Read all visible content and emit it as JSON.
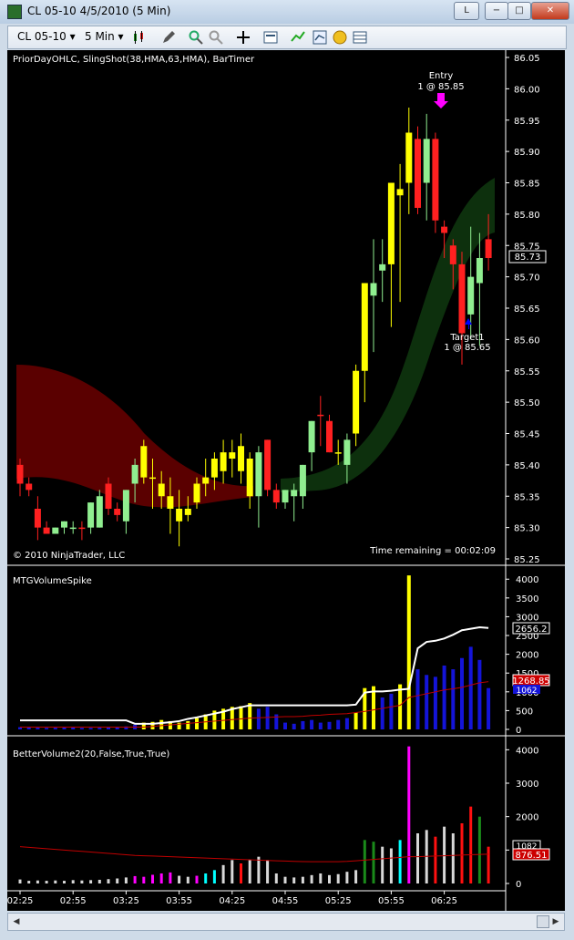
{
  "window": {
    "title": "CL 05-10  4/5/2010 (5 Min)",
    "btn_l": "L",
    "btn_min": "−",
    "btn_max": "□",
    "btn_close": "✕"
  },
  "toolbar": {
    "instrument": "CL 05-10 ▾",
    "period": "5 Min ▾",
    "icons": [
      "candlestick-icon",
      "pencil-icon",
      "zoom-in-icon",
      "zoom-out-icon",
      "crosshair-icon",
      "properties-icon",
      "indicators-icon",
      "strategies-icon",
      "money-icon",
      "data-box-icon"
    ]
  },
  "colors": {
    "bg": "#000000",
    "up_yellow": "#ffff00",
    "up_green": "#90ee90",
    "down_red": "#ff2020",
    "vol_blue": "#1414d8",
    "ma_white": "#ffffff",
    "ma_red": "#c00000",
    "ribbon_red": "#5a0000",
    "ribbon_green": "#0d300d"
  },
  "chart_data": [
    {
      "type": "candlestick",
      "title": "PriorDayOHLC, SlingShot(38,HMA,63,HMA), BarTimer",
      "copyright": "© 2010 NinjaTrader, LLC",
      "timer": "Time remaining = 00:02:09",
      "ylim": [
        85.25,
        86.05
      ],
      "yticks": [
        "86.05",
        "86.00",
        "85.95",
        "85.90",
        "85.85",
        "85.80",
        "85.75",
        "85.70",
        "85.65",
        "85.60",
        "85.55",
        "85.50",
        "85.45",
        "85.40",
        "85.35",
        "85.30",
        "85.25"
      ],
      "last_price_label": "85.73",
      "annotations": {
        "entry": "Entry",
        "entry_fill": "1 @ 85.85",
        "target": "Target1",
        "target_fill": "1 @ 85.65"
      },
      "bars": [
        [
          85.4,
          85.41,
          85.35,
          85.37,
          "r"
        ],
        [
          85.37,
          85.38,
          85.35,
          85.36,
          "r"
        ],
        [
          85.33,
          85.35,
          85.28,
          85.3,
          "r"
        ],
        [
          85.3,
          85.31,
          85.29,
          85.29,
          "r"
        ],
        [
          85.29,
          85.3,
          85.29,
          85.3,
          "g"
        ],
        [
          85.3,
          85.31,
          85.29,
          85.31,
          "g"
        ],
        [
          85.3,
          85.31,
          85.29,
          85.3,
          "g"
        ],
        [
          85.3,
          85.31,
          85.28,
          85.3,
          "r"
        ],
        [
          85.3,
          85.34,
          85.29,
          85.34,
          "g"
        ],
        [
          85.3,
          85.36,
          85.3,
          85.35,
          "g"
        ],
        [
          85.37,
          85.38,
          85.32,
          85.33,
          "r"
        ],
        [
          85.33,
          85.34,
          85.31,
          85.32,
          "r"
        ],
        [
          85.31,
          85.36,
          85.29,
          85.36,
          "g"
        ],
        [
          85.37,
          85.41,
          85.34,
          85.4,
          "g"
        ],
        [
          85.43,
          85.44,
          85.37,
          85.38,
          "y"
        ],
        [
          85.38,
          85.41,
          85.33,
          85.38,
          "y"
        ],
        [
          85.37,
          85.39,
          85.33,
          85.35,
          "y"
        ],
        [
          85.35,
          85.38,
          85.29,
          85.33,
          "y"
        ],
        [
          85.33,
          85.36,
          85.27,
          85.31,
          "y"
        ],
        [
          85.32,
          85.35,
          85.31,
          85.33,
          "y"
        ],
        [
          85.34,
          85.38,
          85.33,
          85.37,
          "y"
        ],
        [
          85.37,
          85.41,
          85.35,
          85.38,
          "y"
        ],
        [
          85.38,
          85.42,
          85.36,
          85.41,
          "y"
        ],
        [
          85.39,
          85.44,
          85.37,
          85.42,
          "y"
        ],
        [
          85.42,
          85.44,
          85.38,
          85.41,
          "y"
        ],
        [
          85.43,
          85.45,
          85.37,
          85.39,
          "y"
        ],
        [
          85.41,
          85.42,
          85.33,
          85.35,
          "y"
        ],
        [
          85.35,
          85.43,
          85.3,
          85.42,
          "g"
        ],
        [
          85.44,
          85.44,
          85.35,
          85.36,
          "r"
        ],
        [
          85.36,
          85.37,
          85.33,
          85.34,
          "r"
        ],
        [
          85.34,
          85.36,
          85.33,
          85.36,
          "g"
        ],
        [
          85.35,
          85.37,
          85.31,
          85.36,
          "g"
        ],
        [
          85.35,
          85.4,
          85.33,
          85.4,
          "g"
        ],
        [
          85.42,
          85.47,
          85.39,
          85.47,
          "g"
        ],
        [
          85.48,
          85.51,
          85.43,
          85.48,
          "r"
        ],
        [
          85.47,
          85.48,
          85.42,
          85.42,
          "r"
        ],
        [
          85.42,
          85.44,
          85.4,
          85.42,
          "y"
        ],
        [
          85.4,
          85.45,
          85.37,
          85.44,
          "g"
        ],
        [
          85.45,
          85.56,
          85.43,
          85.55,
          "y"
        ],
        [
          85.55,
          85.66,
          85.5,
          85.69,
          "y"
        ],
        [
          85.67,
          85.76,
          85.58,
          85.69,
          "g"
        ],
        [
          85.71,
          85.76,
          85.66,
          85.72,
          "g"
        ],
        [
          85.72,
          85.85,
          85.62,
          85.85,
          "y"
        ],
        [
          85.83,
          85.88,
          85.66,
          85.84,
          "y"
        ],
        [
          85.85,
          85.97,
          85.8,
          85.93,
          "y"
        ],
        [
          85.92,
          85.94,
          85.8,
          85.81,
          "r"
        ],
        [
          85.85,
          85.96,
          85.79,
          85.92,
          "g"
        ],
        [
          85.92,
          85.93,
          85.77,
          85.79,
          "r"
        ],
        [
          85.78,
          85.79,
          85.73,
          85.77,
          "r"
        ],
        [
          85.75,
          85.76,
          85.68,
          85.72,
          "r"
        ],
        [
          85.72,
          85.74,
          85.56,
          85.61,
          "r"
        ],
        [
          85.64,
          85.78,
          85.6,
          85.7,
          "g"
        ],
        [
          85.69,
          85.77,
          85.59,
          85.73,
          "g"
        ],
        [
          85.76,
          85.8,
          85.71,
          85.73,
          "r"
        ]
      ]
    },
    {
      "type": "bar",
      "title": "MTGVolumeSpike",
      "ylim": [
        0,
        4200
      ],
      "yticks": [
        "4000",
        "3500",
        "3000",
        "2500",
        "2000",
        "1500",
        "1000",
        "500",
        "0"
      ],
      "last_labels": [
        "2656.2",
        "1268.85",
        "1062"
      ],
      "values": [
        60,
        50,
        45,
        40,
        45,
        60,
        50,
        40,
        40,
        45,
        50,
        55,
        80,
        120,
        180,
        200,
        250,
        220,
        180,
        220,
        300,
        400,
        500,
        550,
        600,
        620,
        700,
        550,
        600,
        400,
        180,
        150,
        220,
        250,
        180,
        200,
        250,
        300,
        450,
        1100,
        1150,
        850,
        950,
        1200,
        4100,
        1600,
        1450,
        1400,
        1700,
        1600,
        1900,
        2200,
        1850,
        1100
      ],
      "colors": [
        "b",
        "b",
        "b",
        "b",
        "b",
        "b",
        "b",
        "b",
        "b",
        "b",
        "b",
        "b",
        "b",
        "b",
        "y",
        "y",
        "y",
        "y",
        "y",
        "y",
        "y",
        "y",
        "y",
        "y",
        "y",
        "y",
        "y",
        "b",
        "b",
        "b",
        "b",
        "b",
        "b",
        "b",
        "b",
        "b",
        "b",
        "b",
        "y",
        "y",
        "y",
        "b",
        "b",
        "y",
        "y",
        "b",
        "b",
        "b",
        "b",
        "b",
        "b",
        "b",
        "b",
        "b"
      ],
      "ma_white": [
        240,
        240,
        240,
        240,
        240,
        240,
        240,
        240,
        240,
        240,
        240,
        240,
        240,
        150,
        150,
        150,
        170,
        190,
        220,
        280,
        320,
        370,
        420,
        470,
        540,
        590,
        640,
        640,
        640,
        640,
        640,
        640,
        640,
        640,
        640,
        640,
        640,
        640,
        660,
        980,
        1010,
        1010,
        1030,
        1060,
        1080,
        2160,
        2330,
        2360,
        2420,
        2520,
        2640,
        2680,
        2720,
        2700
      ],
      "ma_red": [
        60,
        60,
        60,
        60,
        60,
        60,
        60,
        60,
        60,
        60,
        60,
        60,
        60,
        60,
        60,
        80,
        100,
        120,
        140,
        160,
        180,
        200,
        220,
        240,
        260,
        280,
        300,
        310,
        320,
        330,
        340,
        340,
        350,
        370,
        380,
        400,
        410,
        420,
        450,
        480,
        520,
        560,
        600,
        640,
        850,
        900,
        950,
        1000,
        1050,
        1080,
        1120,
        1180,
        1240,
        1270
      ]
    },
    {
      "type": "bar",
      "title": "BetterVolume2(20,False,True,True)",
      "ylim": [
        0,
        4200
      ],
      "yticks": [
        "4000",
        "3000",
        "2000",
        "1000",
        "0"
      ],
      "last_labels": [
        "1082",
        "876.51"
      ],
      "values": [
        120,
        80,
        90,
        80,
        90,
        80,
        100,
        90,
        100,
        110,
        130,
        150,
        180,
        220,
        200,
        260,
        300,
        330,
        230,
        200,
        230,
        300,
        400,
        550,
        700,
        600,
        700,
        800,
        700,
        300,
        200,
        180,
        200,
        250,
        300,
        250,
        280,
        350,
        400,
        1300,
        1250,
        1100,
        1050,
        1300,
        4100,
        1500,
        1600,
        1400,
        1700,
        1500,
        1800,
        2300,
        2000,
        1100
      ],
      "colors": [
        "w",
        "w",
        "w",
        "w",
        "w",
        "w",
        "w",
        "w",
        "w",
        "w",
        "w",
        "w",
        "w",
        "m",
        "m",
        "m",
        "m",
        "m",
        "w",
        "w",
        "m",
        "c",
        "c",
        "w",
        "w",
        "r",
        "w",
        "w",
        "w",
        "w",
        "w",
        "w",
        "w",
        "w",
        "w",
        "w",
        "w",
        "w",
        "w",
        "g",
        "g",
        "w",
        "w",
        "c",
        "m",
        "w",
        "w",
        "r",
        "w",
        "w",
        "r",
        "r",
        "g",
        "r"
      ],
      "ma_red": [
        1100,
        1080,
        1060,
        1040,
        1020,
        1000,
        980,
        960,
        940,
        920,
        900,
        880,
        860,
        840,
        830,
        820,
        810,
        800,
        790,
        780,
        770,
        760,
        750,
        740,
        730,
        720,
        710,
        700,
        690,
        680,
        670,
        660,
        655,
        650,
        650,
        650,
        650,
        660,
        680,
        700,
        720,
        740,
        760,
        780,
        800,
        800,
        810,
        820,
        830,
        840,
        850,
        860,
        870,
        876
      ]
    }
  ],
  "x_labels": [
    "02:25",
    "02:55",
    "03:25",
    "03:55",
    "04:25",
    "04:55",
    "05:25",
    "05:55",
    "06:25"
  ]
}
